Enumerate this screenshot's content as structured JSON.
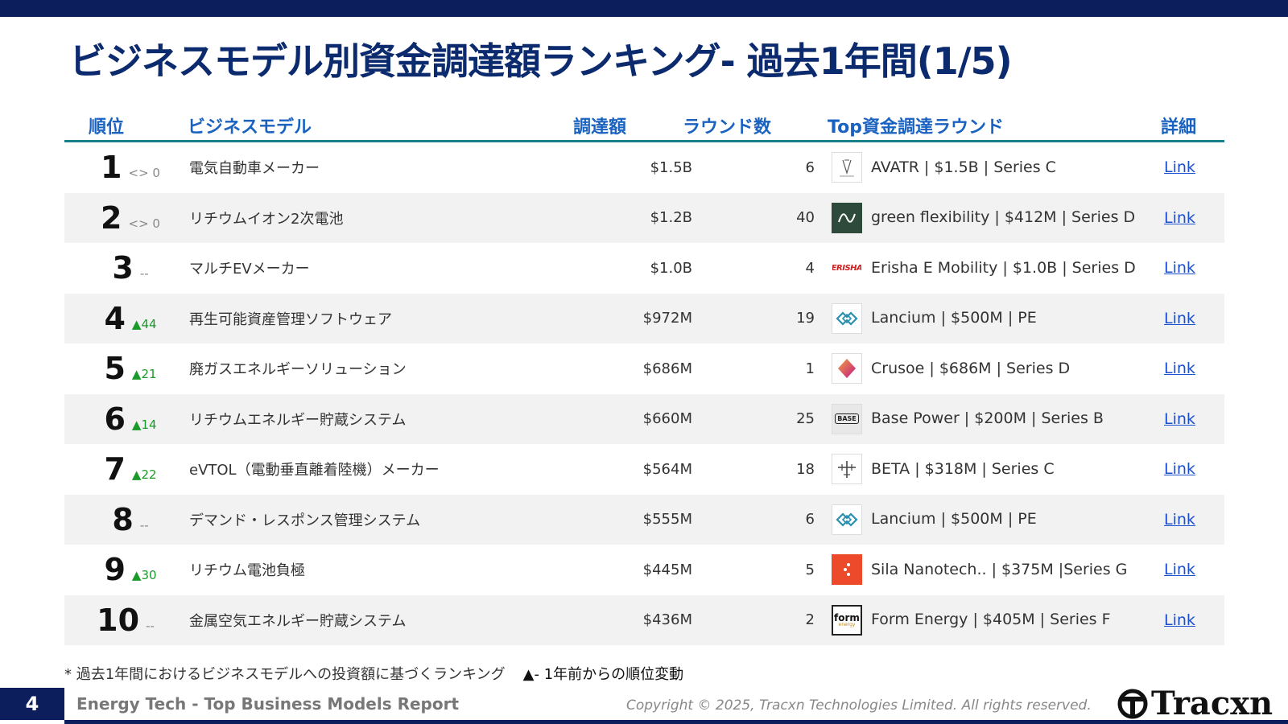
{
  "title": "ビジネスモデル別資金調達額ランキング- 過去1年間(1/5)",
  "headers": {
    "rank": "順位",
    "model": "ビジネスモデル",
    "amount": "調達額",
    "rounds": "ラウンド数",
    "top_round": "Top資金調達ラウンド",
    "detail": "詳細"
  },
  "rows": [
    {
      "rank": "1",
      "change": "<> 0",
      "direction": "same",
      "model": "電気自動車メーカー",
      "amount": "$1.5B",
      "rounds": "6",
      "logo": "avatr-logo",
      "top_round": "AVATR | $1.5B | Series C",
      "link": "Link"
    },
    {
      "rank": "2",
      "change": "<> 0",
      "direction": "same",
      "model": "リチウムイオン2次電池",
      "amount": "$1.2B",
      "rounds": "40",
      "logo": "green-flexibility-logo",
      "top_round": "green flexibility | $412M | Series D",
      "link": "Link"
    },
    {
      "rank": "3",
      "change": "--",
      "direction": "new",
      "model": "マルチEVメーカー",
      "amount": "$1.0B",
      "rounds": "4",
      "logo": "erisha-logo",
      "top_round": "Erisha E Mobility | $1.0B | Series D",
      "link": "Link"
    },
    {
      "rank": "4",
      "change": "44",
      "direction": "up",
      "model": "再生可能資産管理ソフトウェア",
      "amount": "$972M",
      "rounds": "19",
      "logo": "lancium-logo",
      "top_round": "Lancium | $500M | PE",
      "link": "Link"
    },
    {
      "rank": "5",
      "change": "21",
      "direction": "up",
      "model": "廃ガスエネルギーソリューション",
      "amount": "$686M",
      "rounds": "1",
      "logo": "crusoe-logo",
      "top_round": "Crusoe | $686M | Series D",
      "link": "Link"
    },
    {
      "rank": "6",
      "change": "14",
      "direction": "up",
      "model": "リチウムエネルギー貯蔵システム",
      "amount": "$660M",
      "rounds": "25",
      "logo": "base-power-logo",
      "top_round": "Base Power | $200M | Series B",
      "link": "Link"
    },
    {
      "rank": "7",
      "change": "22",
      "direction": "up",
      "model": "eVTOL（電動垂直離着陸機）メーカー",
      "amount": "$564M",
      "rounds": "18",
      "logo": "beta-logo",
      "top_round": "BETA | $318M | Series C",
      "link": "Link"
    },
    {
      "rank": "8",
      "change": "--",
      "direction": "new",
      "model": "デマンド・レスポンス管理システム",
      "amount": "$555M",
      "rounds": "6",
      "logo": "lancium-logo",
      "top_round": "Lancium | $500M | PE",
      "link": "Link"
    },
    {
      "rank": "9",
      "change": "30",
      "direction": "up",
      "model": "リチウム電池負極",
      "amount": "$445M",
      "rounds": "5",
      "logo": "sila-logo",
      "top_round": "Sila Nanotech.. | $375M |Series G",
      "link": "Link"
    },
    {
      "rank": "10",
      "change": "--",
      "direction": "new",
      "model": "金属空気エネルギー貯蔵システム",
      "amount": "$436M",
      "rounds": "2",
      "logo": "form-energy-logo",
      "top_round": "Form Energy | $405M | Series F",
      "link": "Link"
    }
  ],
  "footnote": {
    "text": "* 過去1年間におけるビジネスモデルへの投資額に基づくランキング",
    "legend": "▲- 1年前からの順位変動"
  },
  "footer": {
    "page_number": "4",
    "report_name": "Energy Tech - Top Business Models Report",
    "copyright": "Copyright © 2025, Tracxn Technologies Limited. All rights reserved.",
    "brand": "Tracxn"
  },
  "logo_texts": {
    "erisha": "ERISHA",
    "base": "BASE",
    "form_top": "form",
    "form_bottom": "energy"
  },
  "colors": {
    "navy": "#0c1f5c",
    "title": "#0c2a6e",
    "header": "#1a62c0",
    "rule": "#1a7f8a",
    "up": "#1a9a2a",
    "link": "#1a4fd0"
  }
}
